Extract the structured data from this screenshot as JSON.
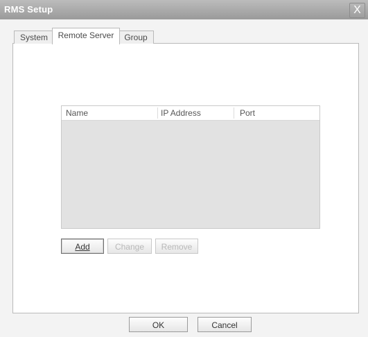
{
  "window": {
    "title": "RMS Setup",
    "close_glyph": "X"
  },
  "tabs": [
    {
      "label": "System"
    },
    {
      "label": "Remote Server",
      "active": true
    },
    {
      "label": "Group"
    }
  ],
  "server_list": {
    "columns": [
      "Name",
      "IP Address",
      "Port"
    ],
    "rows": []
  },
  "list_actions": {
    "add_label": "Add",
    "change_label": "Change",
    "remove_label": "Remove"
  },
  "footer": {
    "ok_label": "OK",
    "cancel_label": "Cancel"
  },
  "colors": {
    "title_bar": "#a8a8a8",
    "list_background": "#e2e2e2",
    "disabled_text": "#b8b8b8"
  }
}
